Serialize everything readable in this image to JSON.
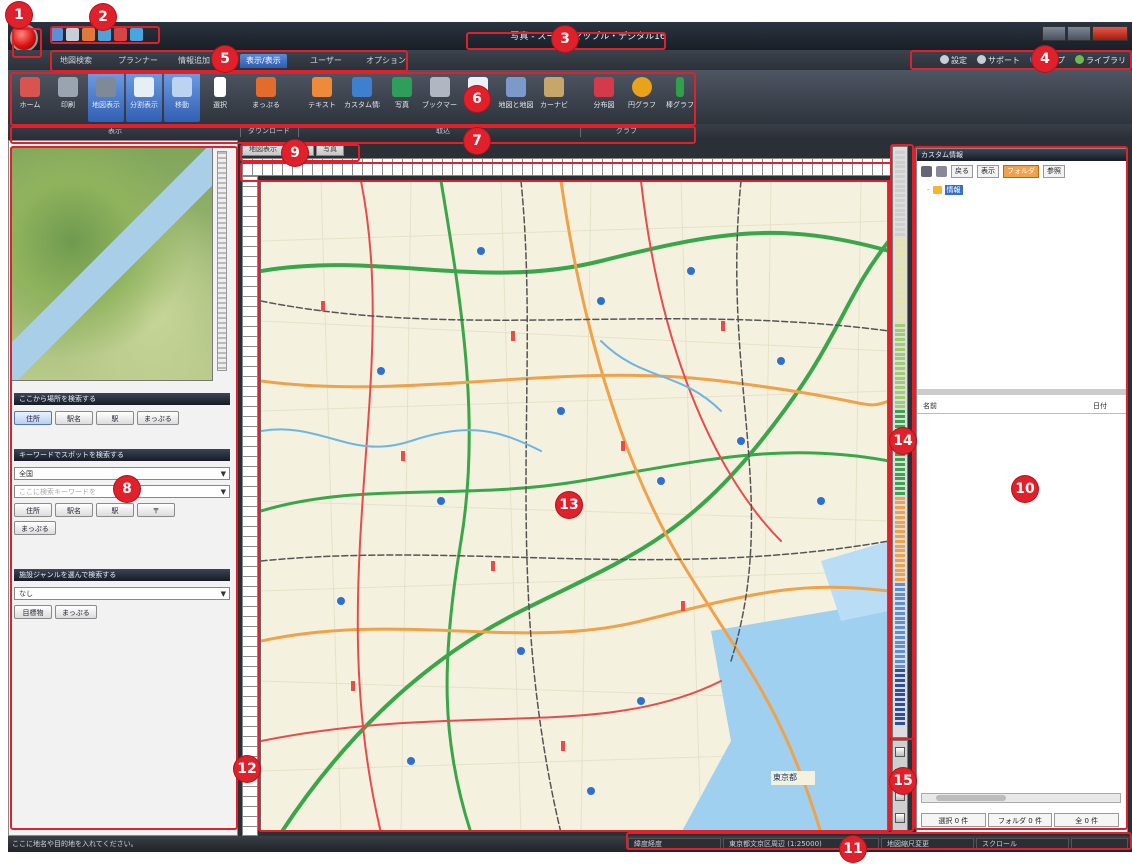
{
  "window": {
    "title": "写真 - スーパーマップル・デジタル16"
  },
  "tabs": [
    {
      "label": "地図検索",
      "active": false
    },
    {
      "label": "プランナー",
      "active": false
    },
    {
      "label": "情報追加",
      "active": false
    },
    {
      "label": "表示/表示",
      "active": true
    },
    {
      "label": "ユーザー",
      "active": false
    },
    {
      "label": "オプション",
      "active": false
    }
  ],
  "help_links": {
    "settings": "設定",
    "support": "サポート",
    "help": "ヘルプ",
    "live": "ライブラリ"
  },
  "ribbon": {
    "buttons": [
      {
        "label": "ホーム",
        "color": "#d9534f",
        "active": false
      },
      {
        "label": "印刷",
        "color": "#9aa4b0",
        "active": false
      },
      {
        "label": "地図表示",
        "color": "#7f8a99",
        "active": true
      },
      {
        "label": "分割表示",
        "color": "#e8eef6",
        "active": true
      },
      {
        "label": "移動",
        "color": "#bcd3f2",
        "active": true
      },
      {
        "label": "選択",
        "color": "#ffffff",
        "active": false
      },
      {
        "label": "まっぷる",
        "color": "#e36b2b",
        "active": false
      },
      {
        "label": "テキスト",
        "color": "#f08a3b",
        "active": false
      },
      {
        "label": "カスタム情報",
        "color": "#3f7fd0",
        "active": false
      },
      {
        "label": "写真",
        "color": "#2d9f5a",
        "active": false
      },
      {
        "label": "ブックマーク",
        "color": "#b0b7c2",
        "active": false
      },
      {
        "label": "Bing",
        "color": "#eef2f7",
        "active": false
      },
      {
        "label": "地図と地図",
        "color": "#7b9acb",
        "active": false
      },
      {
        "label": "カーナビ",
        "color": "#c7a66a",
        "active": false
      },
      {
        "label": "分布図",
        "color": "#d43a4b",
        "active": false
      },
      {
        "label": "円グラフ",
        "color": "#e9a21a",
        "active": false
      },
      {
        "label": "棒グラフ",
        "color": "#2fa14a",
        "active": false
      }
    ],
    "groups": [
      "表示",
      "ダウンロード",
      "取込",
      "グラフ"
    ]
  },
  "left_panel": {
    "section1": {
      "title": "ここから場所を検索する",
      "buttons": [
        "住所",
        "駅名",
        "駅",
        "まっぷる"
      ]
    },
    "section2": {
      "title": "キーワードでスポットを検索する",
      "select": "全国",
      "placeholder": "ここに検索キーワードを",
      "buttons": [
        "住所",
        "駅名",
        "駅",
        "〒"
      ],
      "extra_button": "まっぷる"
    },
    "section3": {
      "title": "施設ジャンルを選んで検索する",
      "select": "なし",
      "buttons": [
        "目標物",
        "まっぷる"
      ]
    }
  },
  "map_tabs": [
    "地図表示",
    "地図",
    "写真"
  ],
  "right_panel": {
    "title": "カスタム情報",
    "tools": [
      "戻る",
      "表示",
      "フォルダ",
      "参照"
    ],
    "tree_folder": "情報",
    "col_name": "名前",
    "col_date": "日付",
    "status": [
      "選択 0 件",
      "フォルダ 0 件",
      "全 0 件"
    ]
  },
  "map_labels": {
    "area": "東京都"
  },
  "status_bar": {
    "message": "ここに地名や目的地を入れてください。",
    "fields": [
      "緯度経度",
      "東京都文京区周辺 (1:25000)",
      "地図縮尺変更",
      "スクロール",
      ""
    ]
  },
  "callouts": [
    "1",
    "2",
    "3",
    "4",
    "5",
    "6",
    "7",
    "8",
    "9",
    "10",
    "11",
    "12",
    "13",
    "14",
    "15"
  ],
  "colors": {
    "accent": "#e0202a",
    "tab_active": "#2c5db0"
  }
}
